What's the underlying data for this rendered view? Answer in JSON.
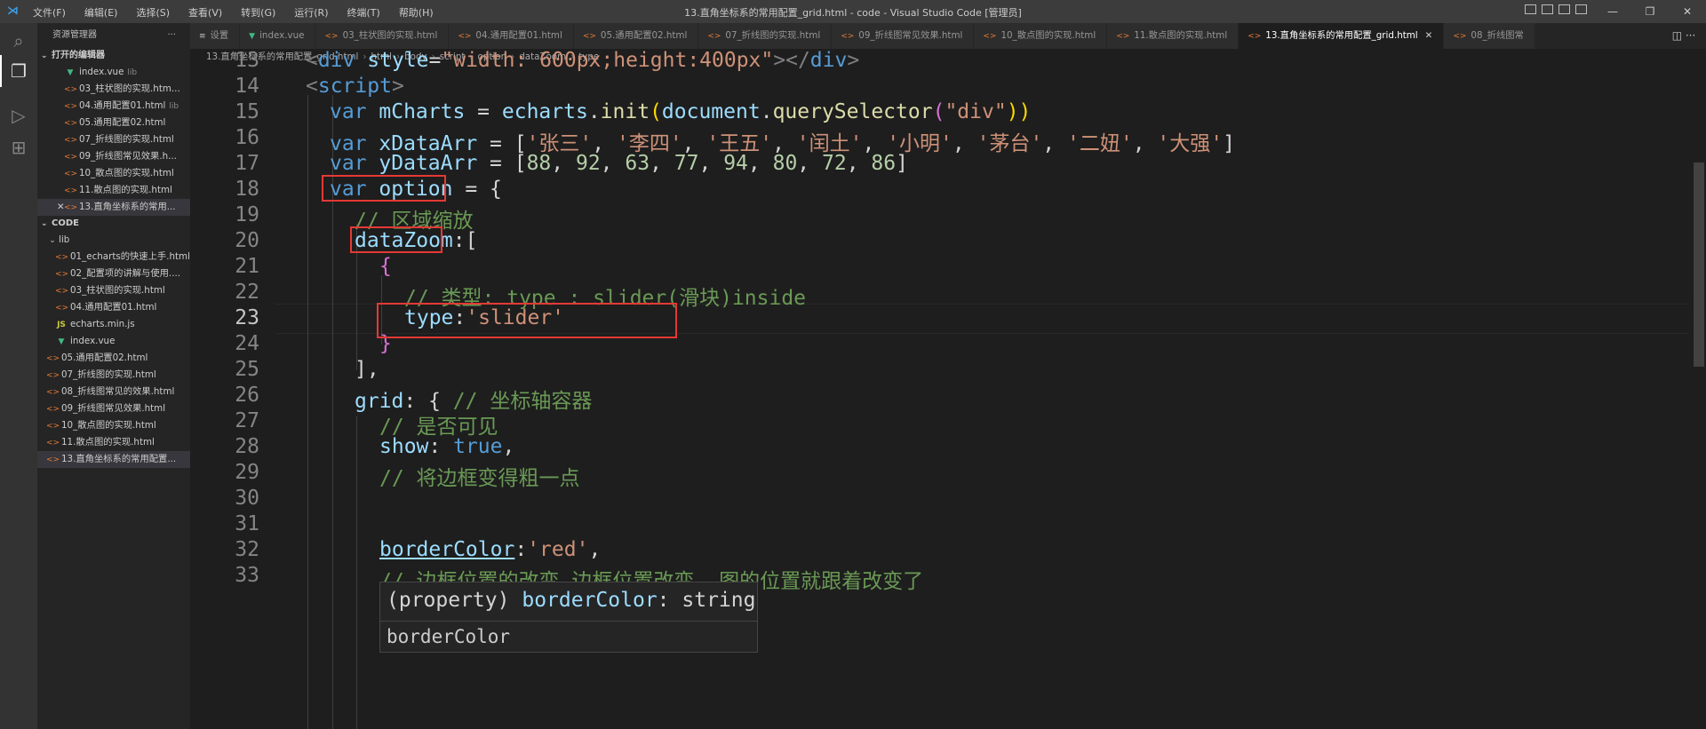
{
  "titlebar": {
    "menus": [
      "文件(F)",
      "编辑(E)",
      "选择(S)",
      "查看(V)",
      "转到(G)",
      "运行(R)",
      "终端(T)",
      "帮助(H)"
    ],
    "window_title": "13.直角坐标系的常用配置_grid.html - code - Visual Studio Code [管理员]",
    "minimize": "—",
    "restore": "❐",
    "close": "✕"
  },
  "sidebar": {
    "header": "资源管理器",
    "more": "···",
    "open_editors_label": "打开的编辑器",
    "open_editors": [
      {
        "name": "index.vue",
        "hint": "lib",
        "type": "vue"
      },
      {
        "name": "03_柱状图的实现.htm...",
        "hint": "",
        "type": "html"
      },
      {
        "name": "04.通用配置01.html",
        "hint": "lib",
        "type": "html"
      },
      {
        "name": "05.通用配置02.html",
        "hint": "",
        "type": "html"
      },
      {
        "name": "07_折线图的实现.html",
        "hint": "",
        "type": "html"
      },
      {
        "name": "09_折线图常见效果.h...",
        "hint": "",
        "type": "html"
      },
      {
        "name": "10_散点图的实现.html",
        "hint": "",
        "type": "html"
      },
      {
        "name": "11.散点图的实现.html",
        "hint": "",
        "type": "html"
      },
      {
        "name": "13.直角坐标系的常用...",
        "hint": "",
        "type": "html",
        "close": "✕"
      }
    ],
    "folder_label": "CODE",
    "lib_label": "lib",
    "lib_items": [
      {
        "name": "01_echarts的快速上手.html",
        "type": "html"
      },
      {
        "name": "02_配置项的讲解与使用....",
        "type": "html"
      },
      {
        "name": "03_柱状图的实现.html",
        "type": "html"
      },
      {
        "name": "04.通用配置01.html",
        "type": "html"
      },
      {
        "name": "echarts.min.js",
        "type": "js"
      },
      {
        "name": "index.vue",
        "type": "vue"
      }
    ],
    "root_items": [
      {
        "name": "05.通用配置02.html",
        "type": "html"
      },
      {
        "name": "07_折线图的实现.html",
        "type": "html"
      },
      {
        "name": "08_折线图常见的效果.html",
        "type": "html"
      },
      {
        "name": "09_折线图常见效果.html",
        "type": "html"
      },
      {
        "name": "10_散点图的实现.html",
        "type": "html"
      },
      {
        "name": "11.散点图的实现.html",
        "type": "html"
      },
      {
        "name": "13.直角坐标系的常用配置...",
        "type": "html"
      }
    ]
  },
  "tabs": [
    {
      "label": "设置",
      "type": "settings"
    },
    {
      "label": "index.vue",
      "type": "vue"
    },
    {
      "label": "03_柱状图的实现.html",
      "type": "html"
    },
    {
      "label": "04.通用配置01.html",
      "type": "html"
    },
    {
      "label": "05.通用配置02.html",
      "type": "html"
    },
    {
      "label": "07_折线图的实现.html",
      "type": "html"
    },
    {
      "label": "09_折线图常见效果.html",
      "type": "html"
    },
    {
      "label": "10_散点图的实现.html",
      "type": "html"
    },
    {
      "label": "11.散点图的实现.html",
      "type": "html"
    },
    {
      "label": "13.直角坐标系的常用配置_grid.html",
      "type": "html",
      "active": true
    },
    {
      "label": "08_折线图常",
      "type": "html"
    }
  ],
  "tab_close": "✕",
  "breadcrumb": [
    "13.直角坐标系的常用配置_grid.html",
    "html",
    "body",
    "script",
    "option",
    "dataZoom",
    "type"
  ],
  "editor": {
    "line_numbers": [
      "13",
      "14",
      "15",
      "16",
      "17",
      "18",
      "19",
      "20",
      "21",
      "22",
      "23",
      "24",
      "25",
      "26",
      "27",
      "28",
      "29",
      "30",
      "31",
      "32",
      "33"
    ],
    "current_line": "23",
    "l13": [
      "<div ",
      "style",
      "=",
      "\"width: 600px;height:400px\"",
      "></div>"
    ],
    "l14": [
      "<script>"
    ],
    "l15": [
      "var ",
      "mCharts",
      " = ",
      "echarts",
      ".",
      "init",
      "(",
      "document",
      ".",
      "querySelector",
      "(",
      "\"div\"",
      "))"
    ],
    "l16_prefix": [
      "var ",
      "xDataArr",
      " = ["
    ],
    "l16_items": [
      "'张三'",
      "'李四'",
      "'王五'",
      "'闰土'",
      "'小明'",
      "'茅台'",
      "'二妞'",
      "'大强'"
    ],
    "l16_suffix": "]",
    "l17_prefix": [
      "var ",
      "yDataArr",
      " = ["
    ],
    "l17_items": [
      "88",
      "92",
      "63",
      "77",
      "94",
      "80",
      "72",
      "86"
    ],
    "l17_suffix": "]",
    "l18": [
      "var ",
      "option",
      " = {"
    ],
    "l19": "// 区域缩放",
    "l20": [
      "dataZoom",
      ":["
    ],
    "l21": "{",
    "l22": "// 类型: type : slider(滑块)inside",
    "l23": [
      "type",
      ":",
      "'slider'"
    ],
    "l24": "}",
    "l25": "],",
    "l26": [
      "grid",
      ": { ",
      "// 坐标轴容器"
    ],
    "l27": "// 是否可见",
    "l28": [
      "show",
      ": ",
      "true",
      ","
    ],
    "l29": "// 将边框变得粗一点",
    "l32": [
      "borderColor",
      ":",
      "'red'",
      ","
    ],
    "l33": "// 边框位置的改变.边框位置改变, 图的位置就跟着改变了"
  },
  "hover": {
    "kind": "(property)",
    "name": "borderColor",
    "sep": ": ",
    "type": "string",
    "doc": "borderColor"
  }
}
